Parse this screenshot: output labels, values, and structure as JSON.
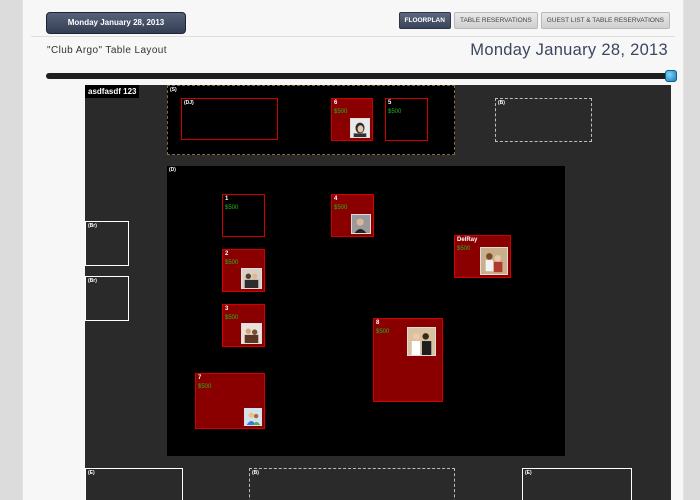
{
  "header": {
    "date_button": "Monday January 28, 2013",
    "tabs": [
      {
        "label": "FLOORPLAN",
        "active": true
      },
      {
        "label": "TABLE RESERVATIONS",
        "active": false
      },
      {
        "label": "GUEST LIST & TABLE RESERVATIONS",
        "active": false
      }
    ]
  },
  "title": "\"Club Argo\" Table Layout",
  "date_display": "Monday January 28, 2013",
  "timeline": {
    "value_fraction": 1.0
  },
  "floor": {
    "venue_name": "asdfasdf 123",
    "areas": {
      "stage": "(S)",
      "dj": "(DJ)",
      "dance": "(D)",
      "bar1": "(Br)",
      "bar2": "(Br)",
      "bath_top": "(B)",
      "bath_bottom": "(B)",
      "exit_left": "(E)",
      "exit_right": "(E)"
    },
    "tables": [
      {
        "number": "6",
        "price": "$500",
        "photo": "portrait-icon"
      },
      {
        "number": "5",
        "price": "$500",
        "photo": ""
      },
      {
        "number": "1",
        "price": "$500",
        "photo": ""
      },
      {
        "number": "4",
        "price": "$500",
        "photo": "portrait-icon"
      },
      {
        "number": "DelRay",
        "price": "$500",
        "photo": "group-photo-icon"
      },
      {
        "number": "2",
        "price": "$500",
        "photo": "group-photo-icon"
      },
      {
        "number": "3",
        "price": "$500",
        "photo": "group-photo-icon"
      },
      {
        "number": "8",
        "price": "$500",
        "photo": "group-photo-icon"
      },
      {
        "number": "7",
        "price": "$500",
        "photo": "avatar-icon"
      }
    ]
  },
  "colors": {
    "accent": "#3c4660",
    "table_fill": "#8a0000",
    "table_border": "#d40000",
    "price_text": "#23b723",
    "floor_bg": "#2a2a2a"
  }
}
